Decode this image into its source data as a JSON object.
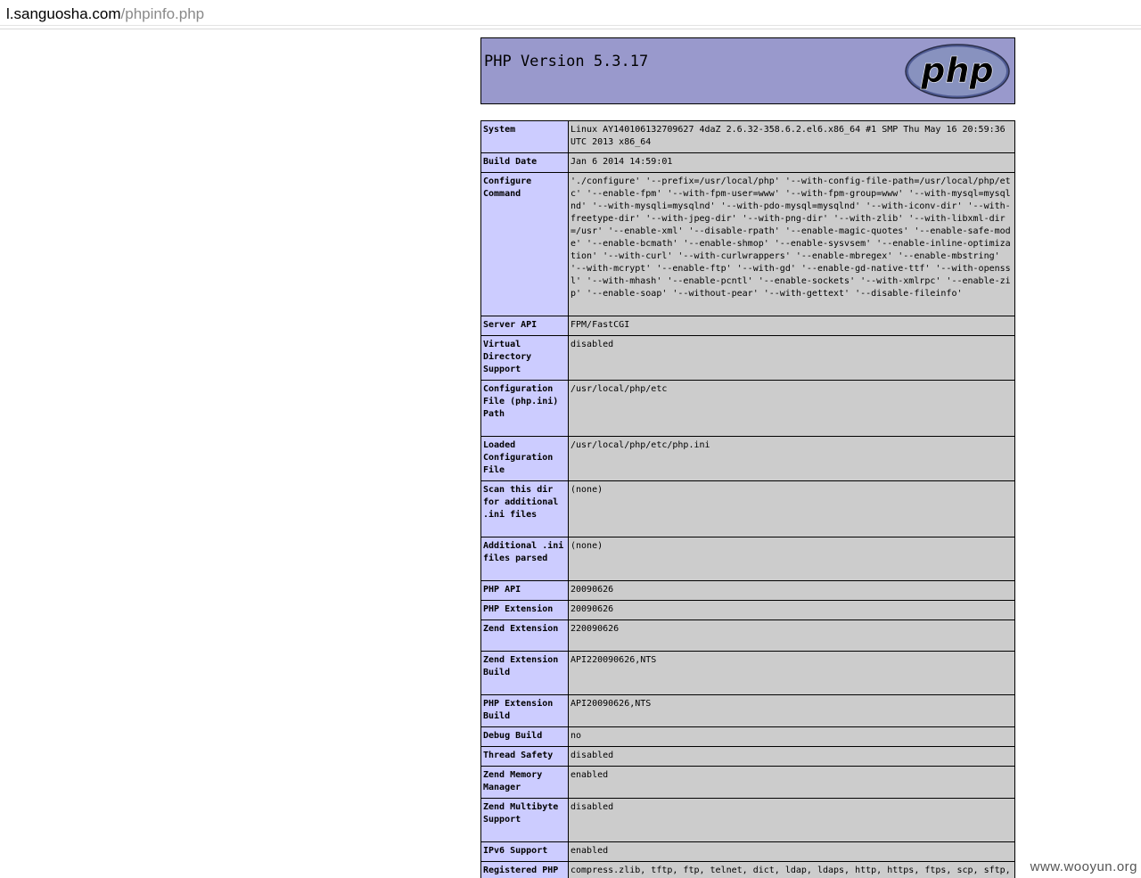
{
  "browser": {
    "url_host": "l.sanguosha.com",
    "url_path": "/phpinfo.php"
  },
  "header": {
    "version_title": "PHP Version 5.3.17",
    "logo_text": "php",
    "colors": {
      "header_bg": "#9999cc",
      "label_bg": "#ccccff",
      "value_bg": "#cccccc",
      "logo_fill": "#6c7eb7"
    }
  },
  "rows": [
    {
      "label": "System",
      "value": "Linux AY140106132709627 4daZ 2.6.32-358.6.2.el6.x86_64 #1 SMP Thu May 16 20:59:36 UTC 2013 x86_64",
      "h": 35
    },
    {
      "label": "Build Date",
      "value": "Jan 6 2014 14:59:01",
      "h": 21
    },
    {
      "label": "Configure Command",
      "value": "'./configure' '--prefix=/usr/local/php' '--with-config-file-path=/usr/local/php/etc' '--enable-fpm' '--with-fpm-user=www' '--with-fpm-group=www' '--with-mysql=mysqlnd' '--with-mysqli=mysqlnd' '--with-pdo-mysql=mysqlnd' '--with-iconv-dir' '--with-freetype-dir' '--with-jpeg-dir' '--with-png-dir' '--with-zlib' '--with-libxml-dir=/usr' '--enable-xml' '--disable-rpath' '--enable-magic-quotes' '--enable-safe-mode' '--enable-bcmath' '--enable-shmop' '--enable-sysvsem' '--enable-inline-optimization' '--with-curl' '--with-curlwrappers' '--enable-mbregex' '--enable-mbstring' '--with-mcrypt' '--enable-ftp' '--with-gd' '--enable-gd-native-ttf' '--with-openssl' '--with-mhash' '--enable-pcntl' '--enable-sockets' '--with-xmlrpc' '--enable-zip' '--enable-soap' '--without-pear' '--with-gettext' '--disable-fileinfo'",
      "h": 161
    },
    {
      "label": "Server API",
      "value": "FPM/FastCGI",
      "h": 21
    },
    {
      "label": "Virtual Directory Support",
      "value": "disabled",
      "h": 49
    },
    {
      "label": "Configuration File (php.ini) Path",
      "value": "/usr/local/php/etc",
      "h": 63
    },
    {
      "label": "Loaded Configuration File",
      "value": "/usr/local/php/etc/php.ini",
      "h": 49
    },
    {
      "label": "Scan this dir for additional .ini files",
      "value": "(none)",
      "h": 63
    },
    {
      "label": "Additional .ini files parsed",
      "value": "(none)",
      "h": 49
    },
    {
      "label": "PHP API",
      "value": "20090626",
      "h": 21
    },
    {
      "label": "PHP Extension",
      "value": "20090626",
      "h": 21
    },
    {
      "label": "Zend Extension",
      "value": "220090626",
      "h": 35
    },
    {
      "label": "Zend Extension Build",
      "value": "API220090626,NTS",
      "h": 49
    },
    {
      "label": "PHP Extension Build",
      "value": "API20090626,NTS",
      "h": 35
    },
    {
      "label": "Debug Build",
      "value": "no",
      "h": 21
    },
    {
      "label": "Thread Safety",
      "value": "disabled",
      "h": 21
    },
    {
      "label": "Zend Memory Manager",
      "value": "enabled",
      "h": 35
    },
    {
      "label": "Zend Multibyte Support",
      "value": "disabled",
      "h": 49
    },
    {
      "label": "IPv6 Support",
      "value": "enabled",
      "h": 21
    },
    {
      "label": "Registered PHP Streams",
      "value": "compress.zlib, tftp, ftp, telnet, dict, ldap, ldaps, http, https, ftps, scp, sftp, php, file, glob, data, phar, zip",
      "h": 35
    }
  ],
  "watermark": "www.wooyun.org"
}
